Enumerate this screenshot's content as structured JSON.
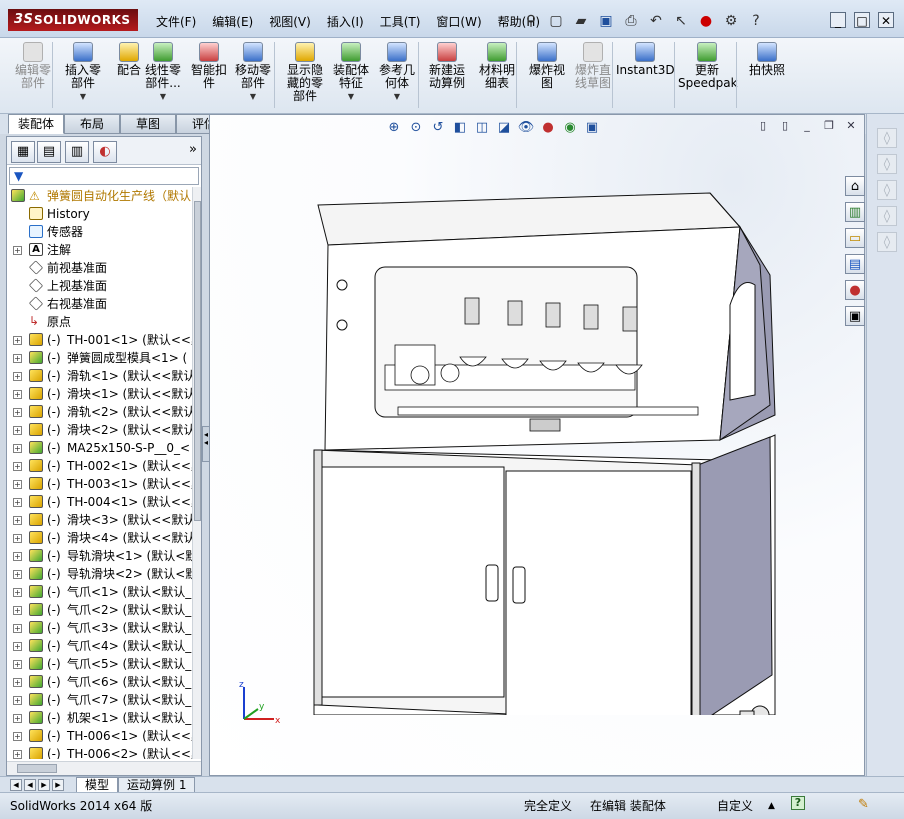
{
  "app": {
    "brand": "SOLIDWORKS",
    "brand_prefix": "3S"
  },
  "menu": [
    "文件(F)",
    "编辑(E)",
    "视图(V)",
    "插入(I)",
    "工具(T)",
    "窗口(W)",
    "帮助(H)"
  ],
  "ribbon": {
    "buttons": [
      {
        "label": "编辑零\n部件",
        "disabled": true
      },
      {
        "label": "插入零\n部件",
        "dropdown": true
      },
      {
        "label": "配合"
      },
      {
        "label": "线性零\n部件...",
        "dropdown": true
      },
      {
        "label": "智能扣\n件"
      },
      {
        "label": "移动零\n部件",
        "dropdown": true
      },
      {
        "label": "显示隐\n藏的零\n部件"
      },
      {
        "label": "装配体\n特征",
        "dropdown": true
      },
      {
        "label": "参考几\n何体",
        "dropdown": true
      },
      {
        "label": "新建运\n动算例"
      },
      {
        "label": "材料明\n细表"
      },
      {
        "label": "爆炸视\n图"
      },
      {
        "label": "爆炸直\n线草图",
        "disabled": true
      },
      {
        "label": "Instant3D"
      },
      {
        "label": "更新\nSpeedpak"
      },
      {
        "label": "拍快照"
      }
    ]
  },
  "command_tabs": [
    "装配体",
    "布局",
    "草图",
    "评估"
  ],
  "feature_manager": {
    "root": "弹簧圆自动化生产线（默认",
    "items": [
      {
        "label": "History",
        "kind": "hist"
      },
      {
        "label": "传感器",
        "kind": "sens"
      },
      {
        "label": "注解",
        "kind": "ann",
        "expand": true
      },
      {
        "label": "前视基准面",
        "kind": "plane"
      },
      {
        "label": "上视基准面",
        "kind": "plane"
      },
      {
        "label": "右视基准面",
        "kind": "plane"
      },
      {
        "label": "原点",
        "kind": "org"
      },
      {
        "label": "TH-001<1> (默认<<默",
        "kind": "part",
        "expand": true,
        "minus": "(-)"
      },
      {
        "label": "弹簧圆成型模具<1> (",
        "kind": "asm",
        "expand": true,
        "minus": "(-)"
      },
      {
        "label": "滑轨<1> (默认<<默认",
        "kind": "part",
        "expand": true,
        "minus": "(-)"
      },
      {
        "label": "滑块<1> (默认<<默认",
        "kind": "part",
        "expand": true,
        "minus": "(-)"
      },
      {
        "label": "滑轨<2> (默认<<默认",
        "kind": "part",
        "expand": true,
        "minus": "(-)"
      },
      {
        "label": "滑块<2> (默认<<默认",
        "kind": "part",
        "expand": true,
        "minus": "(-)"
      },
      {
        "label": "MA25x150-S-P__0_<",
        "kind": "asm",
        "expand": true,
        "minus": "(-)"
      },
      {
        "label": "TH-002<1> (默认<<默",
        "kind": "part",
        "expand": true,
        "minus": "(-)"
      },
      {
        "label": "TH-003<1> (默认<<默",
        "kind": "part",
        "expand": true,
        "minus": "(-)"
      },
      {
        "label": "TH-004<1> (默认<<默",
        "kind": "part",
        "expand": true,
        "minus": "(-)"
      },
      {
        "label": "滑块<3> (默认<<默认",
        "kind": "part",
        "expand": true,
        "minus": "(-)"
      },
      {
        "label": "滑块<4> (默认<<默认",
        "kind": "part",
        "expand": true,
        "minus": "(-)"
      },
      {
        "label": "导轨滑块<1> (默认<默",
        "kind": "asm",
        "expand": true,
        "minus": "(-)"
      },
      {
        "label": "导轨滑块<2> (默认<默",
        "kind": "asm",
        "expand": true,
        "minus": "(-)"
      },
      {
        "label": "气爪<1> (默认<默认_",
        "kind": "asm",
        "expand": true,
        "minus": "(-)"
      },
      {
        "label": "气爪<2> (默认<默认_",
        "kind": "asm",
        "expand": true,
        "minus": "(-)"
      },
      {
        "label": "气爪<3> (默认<默认_",
        "kind": "asm",
        "expand": true,
        "minus": "(-)"
      },
      {
        "label": "气爪<4> (默认<默认_",
        "kind": "asm",
        "expand": true,
        "minus": "(-)"
      },
      {
        "label": "气爪<5> (默认<默认_",
        "kind": "asm",
        "expand": true,
        "minus": "(-)"
      },
      {
        "label": "气爪<6> (默认<默认_",
        "kind": "asm",
        "expand": true,
        "minus": "(-)"
      },
      {
        "label": "气爪<7> (默认<默认_",
        "kind": "asm",
        "expand": true,
        "minus": "(-)"
      },
      {
        "label": "机架<1> (默认<默认_",
        "kind": "asm",
        "expand": true,
        "minus": "(-)"
      },
      {
        "label": "TH-006<1> (默认<<默",
        "kind": "part",
        "expand": true,
        "minus": "(-)"
      },
      {
        "label": "TH-006<2> (默认<<默",
        "kind": "part",
        "expand": true,
        "minus": "(-)"
      }
    ]
  },
  "triad": {
    "x": "x",
    "y": "y",
    "z": "z"
  },
  "bottom_tabs": [
    "模型",
    "运动算例 1"
  ],
  "status": {
    "version": "SolidWorks 2014 x64 版",
    "defined": "完全定义",
    "editing": "在编辑 装配体",
    "units": "自定义",
    "units_arrow": "▲",
    "help": "?"
  },
  "colors": {
    "accent": "#1f4f9c",
    "brand": "#b51a1d",
    "panel": "#9a9bb3"
  }
}
